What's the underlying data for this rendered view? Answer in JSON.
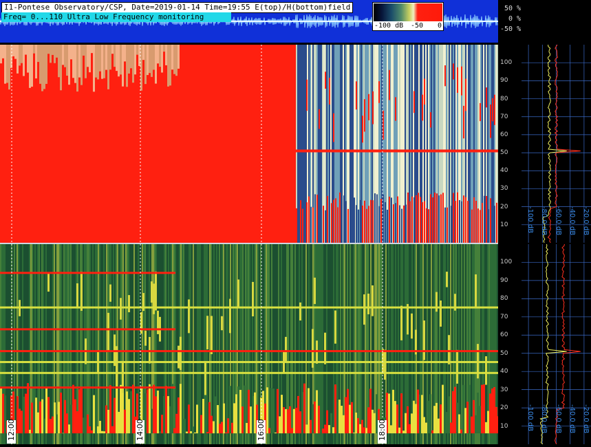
{
  "header": {
    "title": "I1-Pontese Observatory/CSP, Date=2019-01-14 Time=19:55 E(top)/H(bottom)field",
    "freq_label": "Freq= 0...110 Ultra Low Frequency monitoring"
  },
  "colorbar": {
    "labels": [
      "-100 dB",
      "-50",
      "0"
    ]
  },
  "strip_scale": [
    "50 %",
    "0 %",
    "-50 %"
  ],
  "chart_data": [
    {
      "type": "heatmap",
      "name": "E field spectrogram",
      "x_ticks": [
        "12:00",
        "14:00",
        "16:00",
        "18:00"
      ],
      "y_ticks": [
        10,
        20,
        30,
        40,
        50,
        60,
        70,
        80,
        90,
        100
      ],
      "ylim": [
        0,
        110
      ],
      "color_range_db": [
        -100,
        0
      ]
    },
    {
      "type": "heatmap",
      "name": "H field spectrogram",
      "x_ticks": [
        "12:00",
        "14:00",
        "16:00",
        "18:00"
      ],
      "y_ticks": [
        10,
        20,
        30,
        40,
        50,
        60,
        70,
        80,
        90,
        100
      ],
      "ylim": [
        0,
        110
      ],
      "color_range_db": [
        -100,
        0
      ]
    },
    {
      "type": "line",
      "name": "E spectrum",
      "x_ticks": [
        "-100 dB",
        "-80.0 dB",
        "-60.0 dB",
        "-40.0 dB",
        "-20.0 dB"
      ],
      "xlim": [
        -110,
        -10
      ],
      "ylim": [
        0,
        110
      ]
    },
    {
      "type": "line",
      "name": "H spectrum",
      "x_ticks": [
        "-100 dB",
        "-80.0 dB",
        "-60.0 dB",
        "-40.0 dB",
        "-20.0 dB"
      ],
      "xlim": [
        -110,
        -10
      ],
      "ylim": [
        0,
        110
      ]
    }
  ]
}
